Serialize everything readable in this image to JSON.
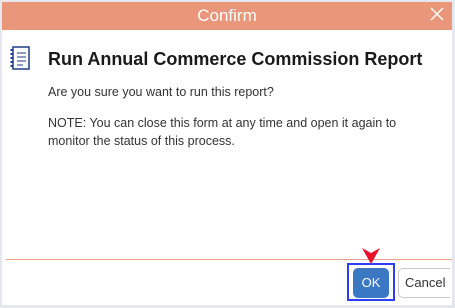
{
  "dialog": {
    "title": "Confirm",
    "heading": "Run Annual Commerce Commission Report",
    "question": "Are you sure you want to run this report?",
    "note": "NOTE: You can close this form at any time and open it again to monitor the status of this process."
  },
  "buttons": {
    "ok_label": "OK",
    "cancel_label": "Cancel"
  },
  "colors": {
    "titlebar": "#ea967a",
    "ok_button": "#3a78c4",
    "highlight": "#2d3ff5",
    "pointer": "#e8102a"
  },
  "icons": {
    "close": "close-icon",
    "document": "document-icon",
    "pointer": "pointer-arrow-icon"
  }
}
